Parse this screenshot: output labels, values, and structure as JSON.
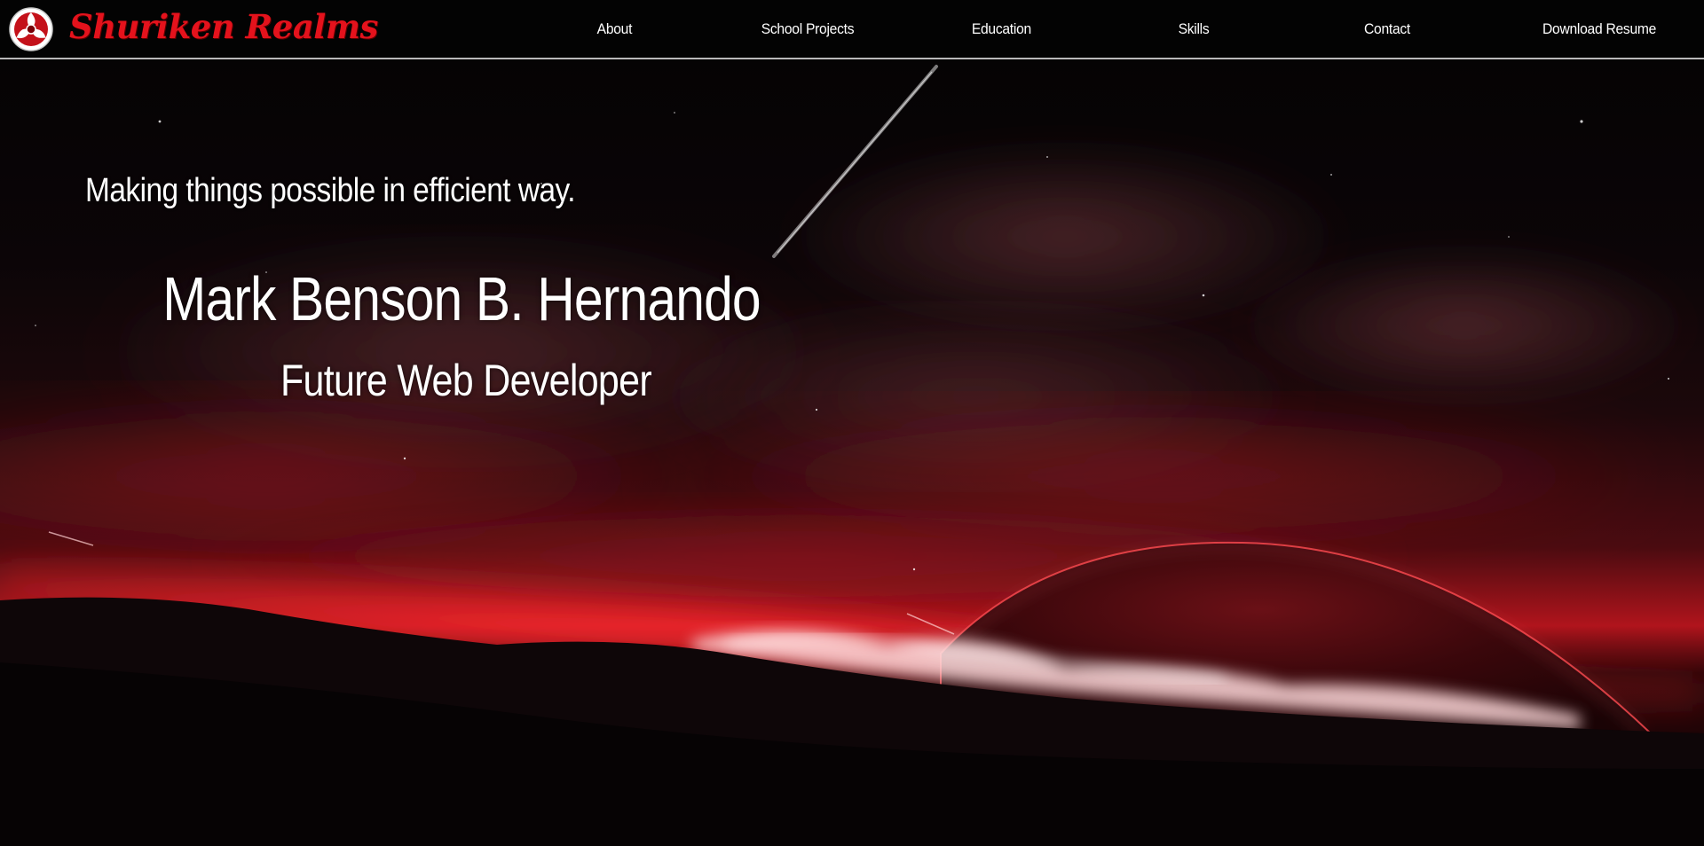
{
  "brand": {
    "name": "Shuriken Realms",
    "logo_icon": "shuriken-emblem-icon",
    "color": "#e4121c"
  },
  "nav": {
    "items": [
      {
        "label": "About"
      },
      {
        "label": "School Projects"
      },
      {
        "label": "Education"
      },
      {
        "label": "Skills"
      },
      {
        "label": "Contact"
      },
      {
        "label": "Download Resume"
      }
    ]
  },
  "hero": {
    "tagline": "Making things possible in efficient way.",
    "name": "Mark Benson B. Hernando",
    "role": "Future Web Developer",
    "background": "space-landscape-with-red-planet",
    "accent_color": "#e0101a"
  }
}
